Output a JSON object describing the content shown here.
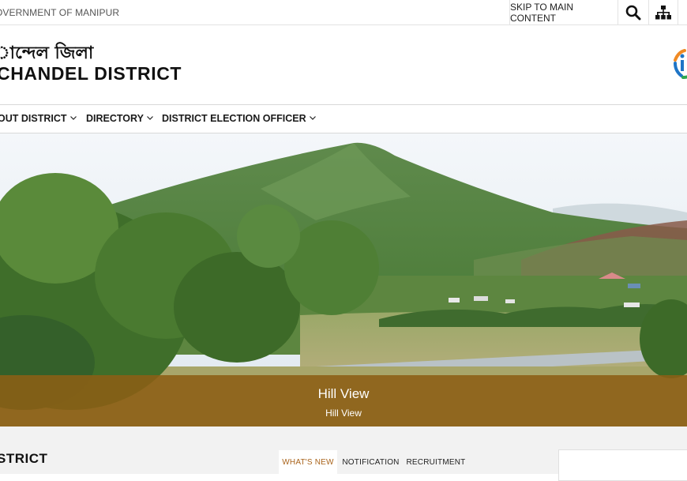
{
  "topbar": {
    "gov_label": "OVERNMENT OF MANIPUR",
    "skip_label": "SKIP TO MAIN CONTENT",
    "search_icon": "search-icon",
    "sitemap_icon": "sitemap-icon"
  },
  "header": {
    "title_local": "ান্দেল জিলা",
    "title_en": "CHANDEL DISTRICT"
  },
  "menu": {
    "items": [
      {
        "label": "OUT DISTRICT"
      },
      {
        "label": "DIRECTORY"
      },
      {
        "label": "DISTRICT ELECTION OFFICER"
      }
    ]
  },
  "banner": {
    "title": "Hill View",
    "subtitle": "Hill View"
  },
  "lower": {
    "section_title": "STRICT",
    "tabs": [
      {
        "label": "WHAT'S NEW"
      },
      {
        "label": "NOTIFICATION"
      },
      {
        "label": "RECRUITMENT"
      }
    ]
  },
  "colors": {
    "caption_bg": "#8c5f14",
    "active_tab_text": "#a9641c"
  }
}
